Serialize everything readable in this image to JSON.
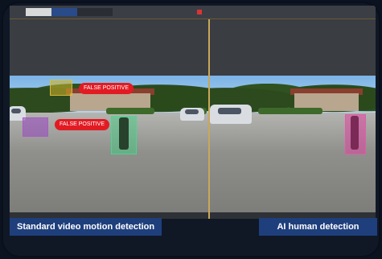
{
  "titlebar": {
    "tabs": [
      "",
      "",
      ""
    ],
    "center_text": ""
  },
  "panels": {
    "left": {
      "labels": {
        "false_positive_1": "FALSE POSITIVE",
        "false_positive_2": "FALSE POSITIVE"
      },
      "caption": "Standard video motion detection"
    },
    "right": {
      "caption": "AI human detection"
    }
  },
  "colors": {
    "caption_bg": "#1e3f7c",
    "false_positive": "#e21b23",
    "motion_box": "#3cd282",
    "ai_box": "#dc46a0",
    "divider": "#c9a75a"
  }
}
